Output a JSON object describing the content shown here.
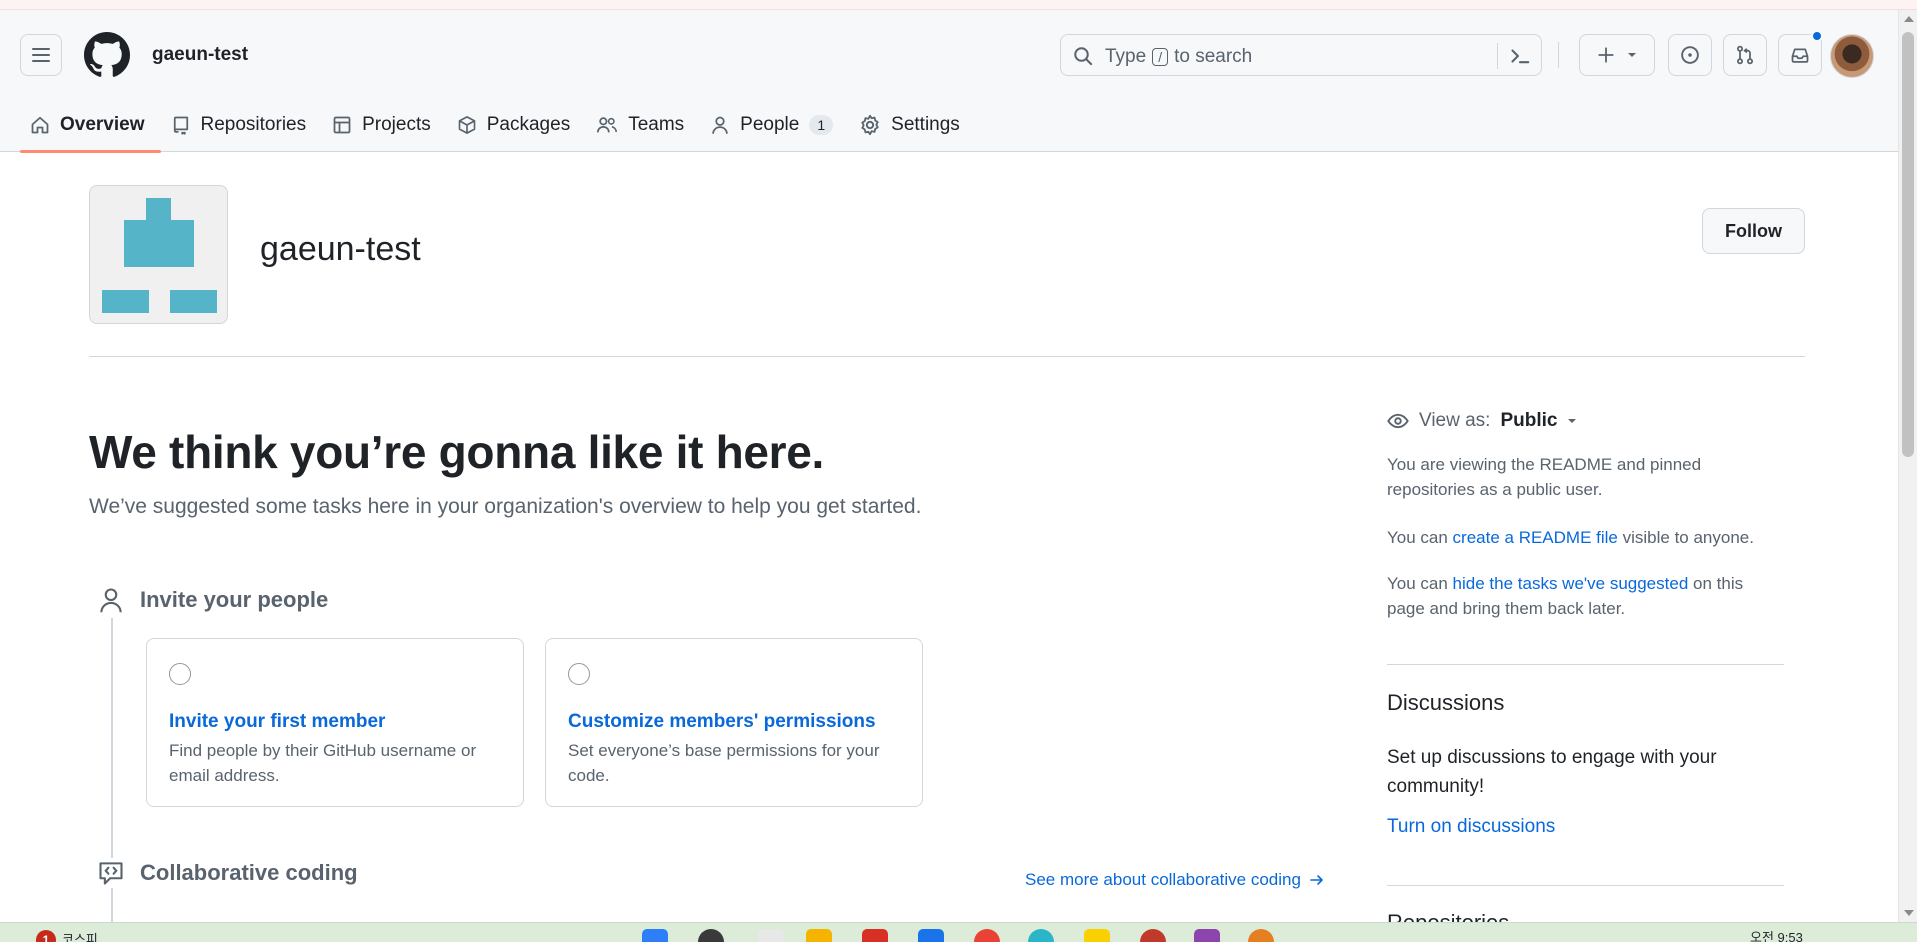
{
  "header": {
    "org_name": "gaeun-test",
    "search": {
      "prefix": "Type",
      "key": "/",
      "suffix": "to search"
    }
  },
  "tabs": [
    {
      "label": "Overview",
      "icon": "home-icon"
    },
    {
      "label": "Repositories",
      "icon": "repo-icon"
    },
    {
      "label": "Projects",
      "icon": "table-icon"
    },
    {
      "label": "Packages",
      "icon": "package-icon"
    },
    {
      "label": "Teams",
      "icon": "people-icon"
    },
    {
      "label": "People",
      "icon": "person-icon",
      "count": "1"
    },
    {
      "label": "Settings",
      "icon": "gear-icon"
    }
  ],
  "org": {
    "title": "gaeun-test",
    "follow_label": "Follow"
  },
  "hero": {
    "title": "We think you’re gonna like it here.",
    "subtitle": "We’ve suggested some tasks here in your organization's overview to help you get started."
  },
  "sections": {
    "invite": {
      "title": "Invite your people",
      "cards": [
        {
          "title": "Invite your first member",
          "desc": "Find people by their GitHub username or email address."
        },
        {
          "title": "Customize members' permissions",
          "desc": "Set everyone’s base permissions for your code."
        }
      ]
    },
    "collab": {
      "title": "Collaborative coding",
      "see_more": "See more about collaborative coding"
    }
  },
  "sidebar": {
    "view_as_prefix": "View as:",
    "view_as_value": "Public",
    "p1": "You are viewing the README and pinned repositories as a public user.",
    "p2_pre": "You can ",
    "p2_link": "create a README file",
    "p2_post": " visible to anyone.",
    "p3_pre": "You can ",
    "p3_link": "hide the tasks we've suggested",
    "p3_post": " on this page and bring them back later.",
    "discussions_title": "Discussions",
    "discussions_text": "Set up discussions to engage with your community!",
    "discussions_link": "Turn on discussions",
    "next_title": "Repositories"
  },
  "taskbar": {
    "badge": "1",
    "label": "코스피",
    "clock": "오전 9:53"
  },
  "colors": {
    "accent": "#0969da",
    "tab_underline": "#fd8c73",
    "identicon": "#56b4c9"
  }
}
